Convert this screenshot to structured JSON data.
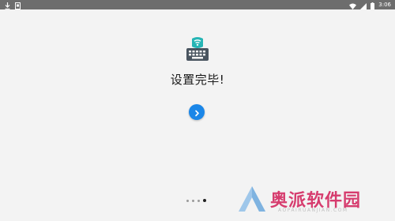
{
  "status_bar": {
    "time": "3:06",
    "left_icons": [
      "download-icon",
      "notification-icon"
    ],
    "right_icons": [
      "wifi-icon",
      "signal-icon",
      "battery-icon"
    ]
  },
  "setup": {
    "app_icon": "keyboard-icon",
    "title": "设置完毕!",
    "next_button_icon": "chevron-right-icon",
    "page_indicator": {
      "total": 4,
      "current": 4
    }
  },
  "watermark": {
    "text": "奥派软件园",
    "subtext": "AOPAIRUANJIAN.COM",
    "color": "#d63c6e"
  },
  "colors": {
    "accent": "#1a86e8",
    "icon_teal": "#26b5b5",
    "icon_dark": "#4a5560",
    "status_bar": "#6d6d6d",
    "background": "#f3f3f3"
  }
}
